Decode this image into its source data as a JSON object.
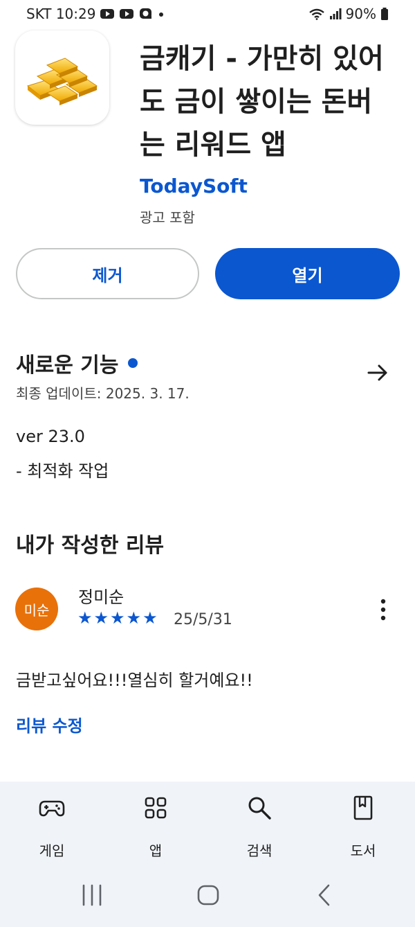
{
  "status_bar": {
    "carrier_time": "SKT 10:29",
    "battery": "90%"
  },
  "app": {
    "title": "금캐기 - 가만히 있어도 금이 쌓이는 돈버는 리워드 앱",
    "developer": "TodaySoft",
    "ads_note": "광고 포함",
    "icon": "gold-bars-icon"
  },
  "actions": {
    "remove_label": "제거",
    "open_label": "열기"
  },
  "whats_new": {
    "title": "새로운 기능",
    "updated": "최종 업데이트: 2025. 3. 17.",
    "version": "ver 23.0",
    "notes": "- 최적화 작업"
  },
  "my_review": {
    "title": "내가 작성한 리뷰",
    "avatar_text": "미순",
    "avatar_color": "#e8710a",
    "reviewer": "정미순",
    "rating": 5,
    "date": "25/5/31",
    "text": "금받고싶어요!!!열심히 할거예요!!",
    "edit_label": "리뷰 수정"
  },
  "bottom_nav": {
    "items": [
      {
        "label": "게임",
        "icon": "gamepad-icon"
      },
      {
        "label": "앱",
        "icon": "apps-grid-icon"
      },
      {
        "label": "검색",
        "icon": "search-icon"
      },
      {
        "label": "도서",
        "icon": "book-icon"
      }
    ]
  },
  "colors": {
    "accent": "#0b57d0",
    "nav_background": "#f0f4f9"
  }
}
